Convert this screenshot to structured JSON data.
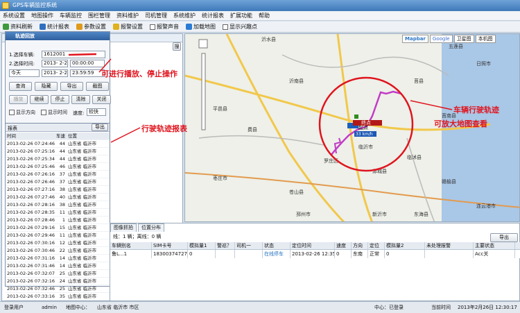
{
  "window": {
    "title": "GPS车辆监控系统"
  },
  "menu": [
    "系统设置",
    "地图操作",
    "车辆监控",
    "围栏管理",
    "资料维护",
    "司机管理",
    "系统维护",
    "统计报表",
    "扩展功能",
    "帮助"
  ],
  "toolbar": {
    "items": [
      {
        "label": "资料刷新",
        "icon": "refresh-icon"
      },
      {
        "label": "统计报表",
        "icon": "report-icon"
      },
      {
        "label": "参数设置",
        "icon": "settings-icon"
      },
      {
        "label": "报警设置",
        "icon": "alarm-icon"
      },
      {
        "label": "报警声音",
        "icon": "sound-icon"
      },
      {
        "label": "加载地图",
        "icon": "map-icon"
      },
      {
        "label": "显示兴趣点",
        "icon": "poi-icon"
      }
    ]
  },
  "left": {
    "search_btn": "搜",
    "tree_lines": [
      "(82/84)",
      "(待车)",
      "(1)",
      "离线)",
      "17386)(离线)",
      "(1)",
      "(1)",
      "(1)",
      "(3/6/9)",
      "(1)",
      "(1)",
      "(3)",
      "(1)"
    ]
  },
  "playback": {
    "title": "轨迹回放",
    "vehicle_label": "1.选择车辆:",
    "vehicle_value": "1612001",
    "time_label": "2.选择时间:",
    "start_date": "2013- 2-24",
    "start_time": "00:00:00",
    "preset": "今天",
    "end_date": "2013- 2-26",
    "end_time": "23:59:59",
    "buttons1": [
      "查询",
      "隐藏",
      "导出",
      "截图"
    ],
    "buttons2": [
      "播放",
      "继续",
      "停止",
      "清除",
      "关闭"
    ],
    "show_direction": "显示方向",
    "show_time": "显示时间",
    "speed_label": "速度:",
    "speed_value": "较快"
  },
  "report": {
    "title": "报表",
    "export": "导出",
    "headers": [
      "时间",
      "车速",
      "位置"
    ],
    "rows": [
      [
        "2013-02-26 07:24:46",
        "44",
        "山东省 临沂市"
      ],
      [
        "2013-02-26 07:25:16",
        "44",
        "山东省 临沂市"
      ],
      [
        "2013-02-26 07:25:34",
        "44",
        "山东省 临沂市"
      ],
      [
        "2013-02-26 07:25:46",
        "46",
        "山东省 临沂市"
      ],
      [
        "2013-02-26 07:26:16",
        "37",
        "山东省 临沂市"
      ],
      [
        "2013-02-26 07:26:46",
        "37",
        "山东省 临沂市"
      ],
      [
        "2013-02-26 07:27:16",
        "38",
        "山东省 临沂市"
      ],
      [
        "2013-02-26 07:27:46",
        "40",
        "山东省 临沂市"
      ],
      [
        "2013-02-26 07:28:16",
        "38",
        "山东省 临沂市"
      ],
      [
        "2013-02-26 07:28:35",
        "11",
        "山东省 临沂市"
      ],
      [
        "2013-02-26 07:28:46",
        "1",
        "山东省 临沂市"
      ],
      [
        "2013-02-26 07:29:16",
        "15",
        "山东省 临沂市"
      ],
      [
        "2013-02-26 07:29:46",
        "11",
        "山东省 临沂市"
      ],
      [
        "2013-02-26 07:30:16",
        "12",
        "山东省 临沂市"
      ],
      [
        "2013-02-26 07:30:46",
        "22",
        "山东省 临沂市"
      ],
      [
        "2013-02-26 07:31:16",
        "14",
        "山东省 临沂市"
      ],
      [
        "2013-02-26 07:31:46",
        "14",
        "山东省 临沂市"
      ],
      [
        "2013-02-26 07:32:07",
        "25",
        "山东省 临沂市"
      ],
      [
        "2013-02-26 07:32:16",
        "24",
        "山东省 临沂市"
      ],
      [
        "2013-02-26 07:32:46",
        "25",
        "山东省 临沂市"
      ],
      [
        "2013-02-26 07:33:16",
        "35",
        "山东省 临沂市"
      ],
      [
        "2013-02-26 07:33:46",
        "33",
        "山东省 临沂市"
      ]
    ]
  },
  "map": {
    "types": [
      "卫星图",
      "本机图"
    ],
    "brands": [
      "Mapbar",
      "Google"
    ],
    "cities": [
      "临沂市",
      "莒南县",
      "沂南县",
      "沂水县",
      "莒县",
      "日照市",
      "费县",
      "平邑县",
      "苍山县",
      "郯城县",
      "枣庄市",
      "邳州市",
      "新沂市",
      "东海县",
      "赣榆县",
      "连云港市",
      "临沭县",
      "罗庄区",
      "五莲县"
    ],
    "start_label": "起点",
    "end_label": "终点",
    "speed_badge": "33 km/h"
  },
  "annotations": {
    "playback": "可进行播放、停止操作",
    "report": "行驶轨迹报表",
    "map1": "车辆行驶轨迹",
    "map2": "可放大地图查看"
  },
  "bottom": {
    "tabs": [
      "图像抓拍",
      "位置分布"
    ],
    "summary": "线：1 辆；离线：0 辆",
    "export": "导出",
    "headers": [
      "车辆别名",
      "SIM卡号",
      "模拟量1",
      "警巡？",
      "司机一",
      "状态",
      "定位时间",
      "速度",
      "方向",
      "定位",
      "模拟量2",
      "未处理报警",
      "主要状态"
    ],
    "row": [
      "鲁L...1",
      "18300374727",
      "0",
      "",
      "",
      "在线停车",
      "2013-02-26 12:35:46",
      "0",
      "东南",
      "正常",
      "0",
      "",
      "Acc关"
    ]
  },
  "status": {
    "user_label": "登录用户",
    "user": "admin",
    "center_label": "地图中心：",
    "center": "山东省 临沂市 市区",
    "conn": "中心：已登录",
    "time_label": "当前时间",
    "time": "2013年2月26日 12:30:17"
  }
}
